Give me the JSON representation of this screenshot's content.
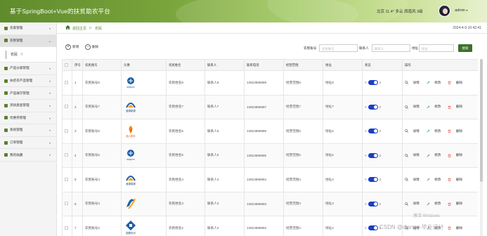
{
  "app": {
    "title": "基于SpringBoot+Vue的扶贫助农平台"
  },
  "header": {
    "weather": "北京 11.4° 多云 西南风 3级",
    "user": "admin",
    "caret": "▾"
  },
  "sidebar": {
    "items": [
      {
        "label": "农家管理",
        "active": false
      },
      {
        "label": "农民管理",
        "active": true
      },
      {
        "label": "产品分类管理",
        "active": false
      },
      {
        "label": "扶贫农产品管理",
        "active": false
      },
      {
        "label": "产品展示管理",
        "active": false
      },
      {
        "label": "测试类查管理",
        "active": false
      },
      {
        "label": "优惠券管理",
        "active": false
      },
      {
        "label": "系统管理",
        "active": false
      },
      {
        "label": "订单管理",
        "active": false
      },
      {
        "label": "我的收藏",
        "active": false
      }
    ],
    "sub_item": "农民"
  },
  "breadcrumb": {
    "home": "返回主页",
    "separator": "▷",
    "current": "农民",
    "time": "2024-4-9 10:42:41"
  },
  "toolbar": {
    "add_label": "新增",
    "delete_label": "删除",
    "filters": [
      {
        "label": "农民账号",
        "placeholder": "农民账号"
      },
      {
        "label": "联系人",
        "placeholder": "联系人"
      },
      {
        "label": "地址",
        "placeholder": "地址"
      }
    ],
    "search_label": "搜索"
  },
  "table": {
    "headers": [
      "",
      "序号",
      "农民账号",
      "头像",
      "农民姓名",
      "联系人",
      "联系电话",
      "经营范围",
      "地址",
      "状态",
      "操作"
    ],
    "switch_left": "<",
    "switch_right": "z",
    "actions": [
      "详情",
      "修改",
      "删除"
    ],
    "rows": [
      {
        "index": "1",
        "account": "农民账号8",
        "avatar": "daqsure",
        "name": "农民姓名8",
        "contact": "联系人8",
        "phone": "13823888888",
        "scope": "经营范围8",
        "address": "地址8"
      },
      {
        "index": "2",
        "account": "农民账号7",
        "avatar": "鑫源能源",
        "name": "农民姓名7",
        "contact": "联系人7",
        "phone": "13823888887",
        "scope": "经营范围7",
        "address": "地址7"
      },
      {
        "index": "3",
        "account": "农民账号6",
        "avatar": "维心服务",
        "name": "农民姓名6",
        "contact": "联系人6",
        "phone": "13823888886",
        "scope": "经营范围6",
        "address": "地址6"
      },
      {
        "index": "4",
        "account": "农民账号5",
        "avatar": "daqsure",
        "name": "农民姓名5",
        "contact": "联系人5",
        "phone": "13823888885",
        "scope": "经营范围5",
        "address": "地址5"
      },
      {
        "index": "5",
        "account": "农民账号4",
        "avatar": "鑫源能源",
        "name": "农民姓名4",
        "contact": "联系人4",
        "phone": "13823888884",
        "scope": "经营范围4",
        "address": "地址4"
      },
      {
        "index": "6",
        "account": "农民账号3",
        "avatar": "",
        "name": "农民姓名3",
        "contact": "联系人3",
        "phone": "13823888883",
        "scope": "经营范围3",
        "address": "地址3"
      },
      {
        "index": "7",
        "account": "农民账号2",
        "avatar": "国泰标识",
        "name": "农民姓名2",
        "contact": "联系人2",
        "phone": "13823888882",
        "scope": "经营范围2",
        "address": "地址2"
      }
    ]
  },
  "watermark": {
    "line1": "激活 Windows",
    "line2": "CSDN @django-毕业设计"
  },
  "colors": {
    "accent": "#3d6f2b",
    "toggle": "#1a3ec9",
    "header": "#7aa53c"
  }
}
